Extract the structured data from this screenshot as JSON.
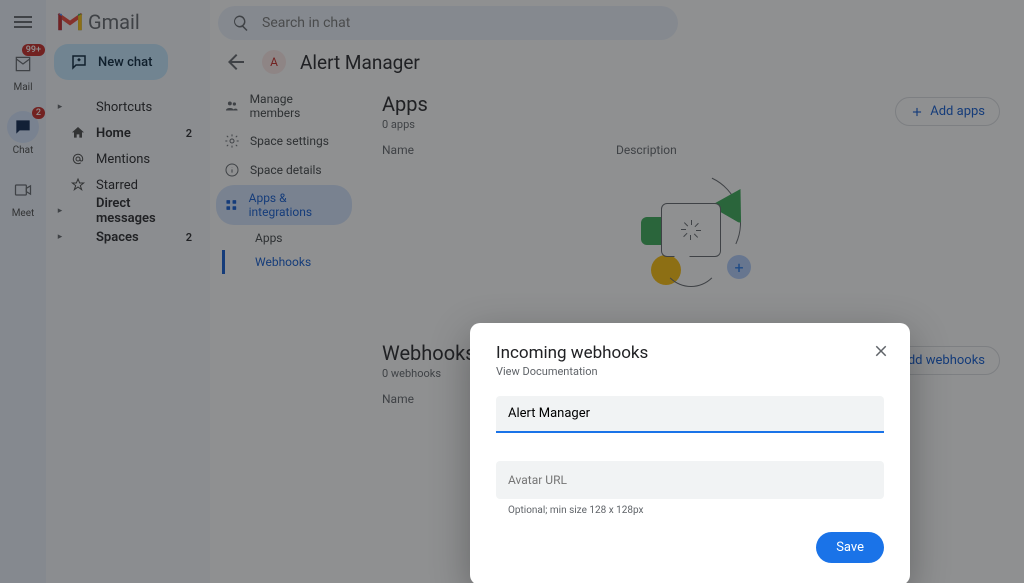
{
  "search": {
    "placeholder": "Search in chat"
  },
  "rail": {
    "mail": {
      "label": "Mail",
      "badge": "99+"
    },
    "chat": {
      "label": "Chat",
      "badge": "2"
    },
    "meet": {
      "label": "Meet"
    }
  },
  "logo": {
    "text": "Gmail"
  },
  "new_chat": {
    "label": "New chat"
  },
  "sidebar": {
    "items": [
      {
        "label": "Shortcuts",
        "icon": "caret"
      },
      {
        "label": "Home",
        "icon": "home",
        "count": "2",
        "bold": true
      },
      {
        "label": "Mentions",
        "icon": "at"
      },
      {
        "label": "Starred",
        "icon": "star"
      },
      {
        "label": "Direct messages",
        "icon": "caret",
        "bold": true
      },
      {
        "label": "Spaces",
        "icon": "caret",
        "count": "2",
        "bold": true
      }
    ]
  },
  "space": {
    "title": "Alert Manager",
    "initial": "A"
  },
  "menu": {
    "members": "Manage members",
    "settings": "Space settings",
    "details": "Space details",
    "apps": "Apps & integrations",
    "sub_apps": "Apps",
    "sub_webhooks": "Webhooks"
  },
  "apps_panel": {
    "title": "Apps",
    "sub": "0 apps",
    "add": "Add apps",
    "col_name": "Name",
    "col_desc": "Description"
  },
  "webhooks_panel": {
    "title": "Webhooks",
    "sub": "0 webhooks",
    "add": "Add webhooks",
    "col_name": "Name"
  },
  "dialog": {
    "title": "Incoming webhooks",
    "doc_link": "View Documentation",
    "name_value": "Alert Manager",
    "avatar_placeholder": "Avatar URL",
    "helper": "Optional; min size 128 x 128px",
    "save": "Save"
  }
}
